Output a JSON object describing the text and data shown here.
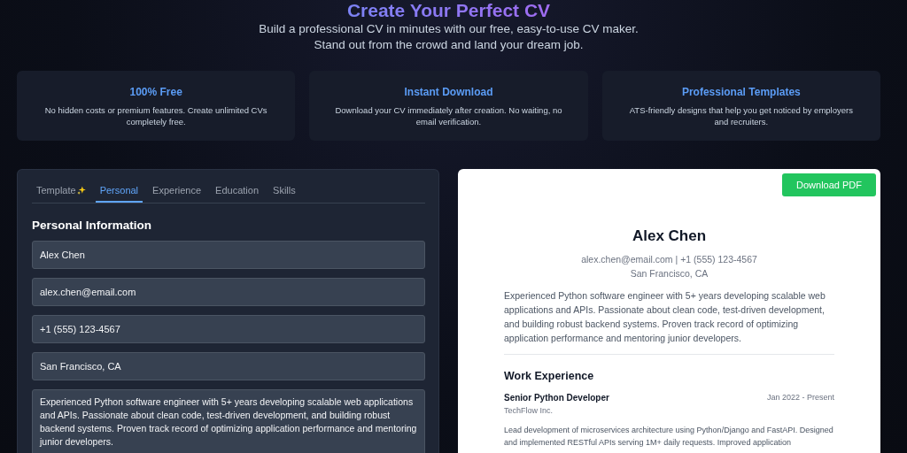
{
  "hero": {
    "title": "Create Your Perfect CV",
    "subtitle_lines": [
      "Build a professional CV in minutes with our free, easy-to-use CV maker.",
      "Stand out from the crowd and land your dream job."
    ]
  },
  "features": [
    {
      "title": "100% Free",
      "text": "No hidden costs or premium features. Create unlimited CVs completely free."
    },
    {
      "title": "Instant Download",
      "text": "Download your CV immediately after creation. No waiting, no email verification."
    },
    {
      "title": "Professional Templates",
      "text": "ATS-friendly designs that help you get noticed by employers and recruiters."
    }
  ],
  "editor": {
    "tabs": [
      {
        "label": "Template",
        "sparkle": true,
        "selected": false
      },
      {
        "label": "Personal",
        "sparkle": false,
        "selected": true
      },
      {
        "label": "Experience",
        "sparkle": false,
        "selected": false
      },
      {
        "label": "Education",
        "sparkle": false,
        "selected": false
      },
      {
        "label": "Skills",
        "sparkle": false,
        "selected": false
      }
    ],
    "heading": "Personal Information",
    "fields": [
      {
        "kind": "input",
        "value": "Alex Chen"
      },
      {
        "kind": "input",
        "value": "alex.chen@email.com"
      },
      {
        "kind": "input",
        "value": "+1 (555) 123-4567"
      },
      {
        "kind": "input",
        "value": "San Francisco, CA"
      },
      {
        "kind": "textarea",
        "value": "Experienced Python software engineer with 5+ years developing scalable web applications and APIs. Passionate about clean code, test-driven development, and building robust backend systems. Proven track record of optimizing application performance and mentoring junior developers."
      }
    ]
  },
  "preview": {
    "download_button": "Download PDF",
    "name": "Alex Chen",
    "contact": "alex.chen@email.com | +1 (555) 123-4567",
    "location": "San Francisco, CA",
    "summary": "Experienced Python software engineer with 5+ years developing scalable web applications and APIs. Passionate about clean code, test-driven development, and building robust backend systems. Proven track record of optimizing application performance and mentoring junior developers.",
    "section_title": "Work Experience",
    "jobs": [
      {
        "title": "Senior Python Developer",
        "dates": "Jan 2022 - Present",
        "company": "TechFlow Inc.",
        "description": "Lead development of microservices architecture using Python/Django and FastAPI. Designed and implemented RESTful APIs serving 1M+ daily requests. Improved application"
      }
    ]
  }
}
